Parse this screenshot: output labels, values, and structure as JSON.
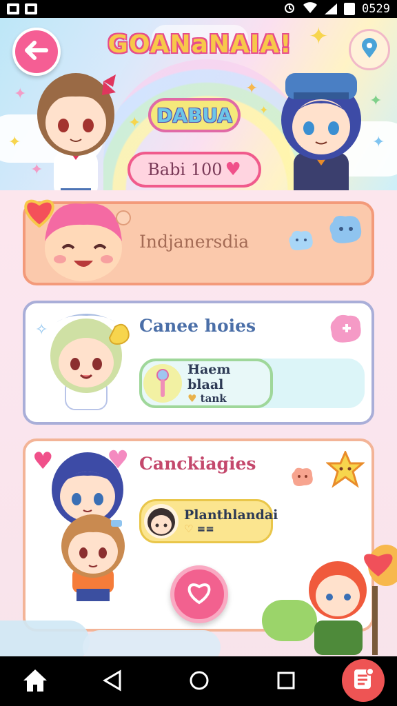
{
  "status_bar": {
    "time": "0529"
  },
  "header": {
    "app_title": "GOANaNAIA!",
    "subtitle": "DABUA",
    "pill_label": "Babi 100"
  },
  "cards": [
    {
      "title": "Indjanersdia"
    },
    {
      "title": "Canee hoies",
      "pill_line1": "Haem blaal",
      "pill_line2": "tank"
    },
    {
      "title": "Canckiagies",
      "pill_line1": "Planthlandai",
      "pill_line2": "≡≡"
    }
  ],
  "icons": {
    "back": "arrow-left-icon",
    "map": "map-pin-icon",
    "favorite": "heart-icon",
    "home": "home-icon",
    "nav_back": "triangle-back-icon",
    "nav_home": "circle-home-icon",
    "recents": "square-recents-icon",
    "menu": "list-menu-icon"
  },
  "colors": {
    "accent_pink": "#f55e94",
    "card1_bg": "#fbc9ac",
    "card2_border": "#a9aed8",
    "card3_border": "#f3b497",
    "menu_fab": "#ee5454"
  }
}
